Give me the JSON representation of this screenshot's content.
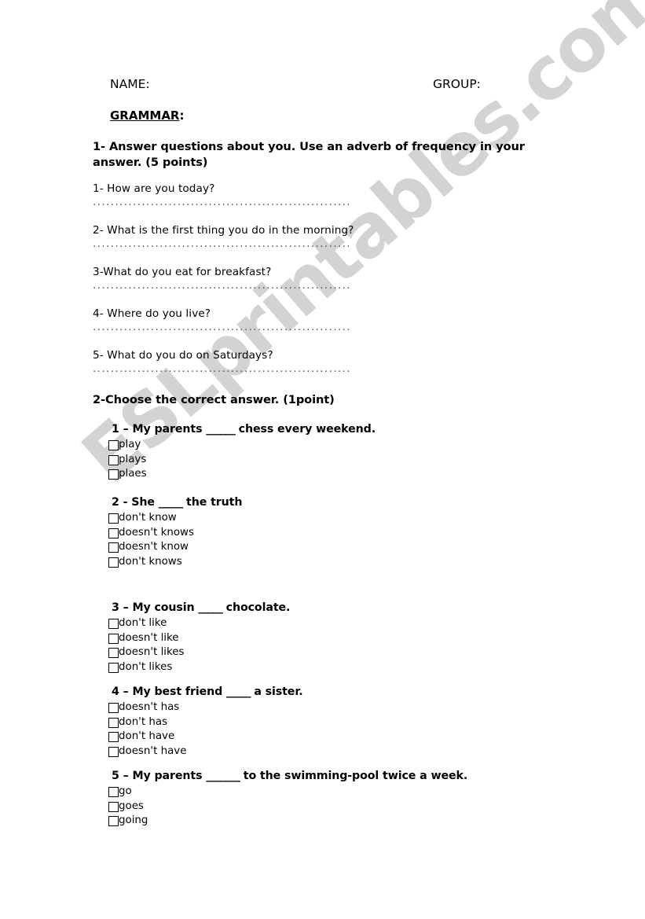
{
  "header": {
    "name_label": "NAME:",
    "group_label": "GROUP:"
  },
  "section_title": {
    "text": "GRAMMAR",
    "colon": ":"
  },
  "exercise1": {
    "instruction": "1- Answer questions about you. Use an adverb of frequency in your answer. (5 points)",
    "dots": "..........................................................",
    "questions": [
      "1- How are you today?",
      "2- What is the first thing you do in the morning?",
      "3-What do you eat for breakfast?",
      "4- Where do you live?",
      "5- What do you do on Saturdays?"
    ]
  },
  "exercise2": {
    "instruction": "2-Choose the correct answer. (1point)",
    "questions": [
      {
        "stem_before": "1 – My parents  ",
        "blank": "______",
        "stem_after": " chess every weekend.",
        "options": [
          "play",
          "plays",
          "plaes"
        ]
      },
      {
        "stem_before": "2 - She ",
        "blank": "_____",
        "stem_after": " the truth",
        "options": [
          "don't know",
          "doesn't knows",
          "doesn't know",
          "don't knows"
        ]
      },
      {
        "stem_before": "3 – My cousin  ",
        "blank": "_____",
        "stem_after": " chocolate.",
        "options": [
          "don't like",
          "doesn't like",
          "doesn't likes",
          "don't likes"
        ]
      },
      {
        "stem_before": "4 – My best friend ",
        "blank": "_____",
        "stem_after": " a sister.",
        "options": [
          "doesn't has",
          "don't has",
          "don't have",
          "doesn't have"
        ]
      },
      {
        "stem_before": "5 – My parents ",
        "blank": "_______",
        "stem_after": " to the swimming-pool twice a week.",
        "options": [
          "go",
          "goes",
          "going"
        ]
      }
    ]
  },
  "watermark": {
    "text": "ESLprintables.com",
    "color": "#d3d3d3"
  }
}
